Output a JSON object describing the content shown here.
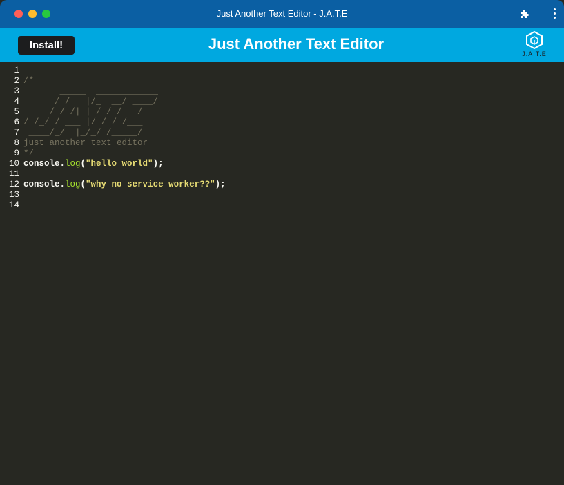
{
  "window": {
    "title": "Just Another Text Editor - J.A.T.E"
  },
  "navbar": {
    "install_label": "Install!",
    "app_title": "Just Another Text Editor",
    "logo_text": "J.A.T.E"
  },
  "editor": {
    "lines": [
      {
        "num": "1",
        "parts": []
      },
      {
        "num": "2",
        "parts": [
          {
            "t": "/*",
            "c": "cmt"
          }
        ]
      },
      {
        "num": "3",
        "parts": [
          {
            "t": "       _____  ____________",
            "c": "cmt"
          }
        ]
      },
      {
        "num": "4",
        "parts": [
          {
            "t": "      / /   |/_  __/ ____/",
            "c": "cmt"
          }
        ]
      },
      {
        "num": "5",
        "parts": [
          {
            "t": " __  / / /| | / / / __/",
            "c": "cmt"
          }
        ]
      },
      {
        "num": "6",
        "parts": [
          {
            "t": "/ /_/ / ___ |/ / / /___",
            "c": "cmt"
          }
        ]
      },
      {
        "num": "7",
        "parts": [
          {
            "t": " ____/_/  |_/_/ /_____/",
            "c": "cmt"
          }
        ]
      },
      {
        "num": "8",
        "parts": [
          {
            "t": "just another text editor",
            "c": "cmt"
          }
        ]
      },
      {
        "num": "9",
        "parts": [
          {
            "t": "*/",
            "c": "cmt"
          }
        ]
      },
      {
        "num": "10",
        "parts": [
          {
            "t": "console.",
            "c": "plain"
          },
          {
            "t": "log",
            "c": "fn"
          },
          {
            "t": "(",
            "c": "plain"
          },
          {
            "t": "\"hello world\"",
            "c": "str"
          },
          {
            "t": ");",
            "c": "plain"
          }
        ]
      },
      {
        "num": "11",
        "parts": []
      },
      {
        "num": "12",
        "parts": [
          {
            "t": "console.",
            "c": "plain"
          },
          {
            "t": "log",
            "c": "fn"
          },
          {
            "t": "(",
            "c": "plain"
          },
          {
            "t": "\"why no service worker??\"",
            "c": "str"
          },
          {
            "t": ");",
            "c": "plain"
          }
        ]
      },
      {
        "num": "13",
        "parts": []
      },
      {
        "num": "14",
        "parts": []
      }
    ]
  },
  "icons": {
    "extensions": "puzzle-piece-icon",
    "menu": "kebab-menu-icon",
    "logo": "cube-logo-icon"
  },
  "colors": {
    "titlebar": "#0b5fa3",
    "navbar": "#00a8e0",
    "editor_bg": "#272822",
    "button_bg": "#1c1d1e"
  }
}
